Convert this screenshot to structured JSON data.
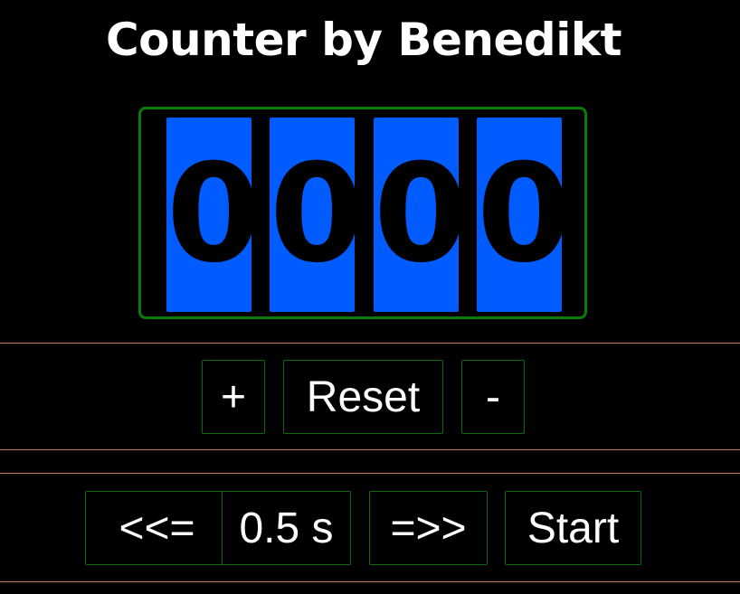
{
  "app": {
    "title": "Counter by Benedikt"
  },
  "counter": {
    "digits": [
      "0",
      "0",
      "0",
      "0"
    ]
  },
  "controls": {
    "increment_label": "+",
    "reset_label": "Reset",
    "decrement_label": "-"
  },
  "auto": {
    "slower_label": "<<=",
    "interval_label": "0.5 s",
    "faster_label": "=>>",
    "start_label": "Start"
  },
  "colors": {
    "background": "#000000",
    "digit_background": "#005cff",
    "frame_border": "#0a7a0a",
    "button_border": "#0b6a0b",
    "divider": "#c8784a"
  }
}
